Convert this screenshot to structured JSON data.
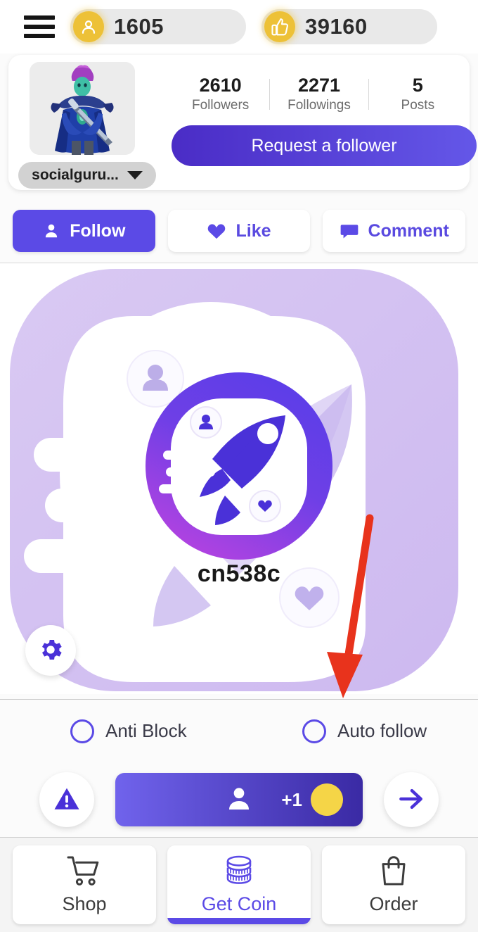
{
  "topbar": {
    "menu_icon": "hamburger-menu-icon",
    "coins": {
      "icon": "person-coin-icon",
      "value": "1605"
    },
    "likes": {
      "icon": "thumbs-up-coin-icon",
      "value": "39160"
    }
  },
  "profile": {
    "avatar_alt": "user-avatar",
    "username": "socialguru...",
    "dropdown_icon": "chevron-down-icon",
    "stats": [
      {
        "num": "2610",
        "label": "Followers"
      },
      {
        "num": "2271",
        "label": "Followings"
      },
      {
        "num": "5",
        "label": "Posts"
      }
    ],
    "request_button": "Request a follower"
  },
  "actions": [
    {
      "label": "Follow",
      "icon": "person-icon",
      "primary": true
    },
    {
      "label": "Like",
      "icon": "heart-icon",
      "primary": false
    },
    {
      "label": "Comment",
      "icon": "comment-icon",
      "primary": false
    }
  ],
  "illustration": {
    "app_name": "cn538c",
    "logo_icon": "rocket-logo-icon",
    "gear_icon": "gear-icon",
    "annotation_arrow": "red-down-arrow"
  },
  "options": [
    {
      "label": "Anti Block",
      "checked": false
    },
    {
      "label": "Auto follow",
      "checked": false
    }
  ],
  "actionbar": {
    "warning_icon": "warning-triangle-icon",
    "main_button": {
      "icon": "person-icon",
      "reward": "+1",
      "coin_icon": "gold-coin-icon"
    },
    "next_icon": "arrow-right-icon"
  },
  "bottomnav": [
    {
      "label": "Shop",
      "icon": "shopping-cart-icon",
      "active": false
    },
    {
      "label": "Get Coin",
      "icon": "coin-stack-icon",
      "active": true
    },
    {
      "label": "Order",
      "icon": "shopping-bag-icon",
      "active": false
    }
  ],
  "colors": {
    "accent_purple": "#5b4ae6",
    "deep_purple": "#3a2aa4",
    "coin_gold": "#edc137",
    "card_lilac": "#d7c6f2",
    "arrow_red": "#e8331c"
  }
}
